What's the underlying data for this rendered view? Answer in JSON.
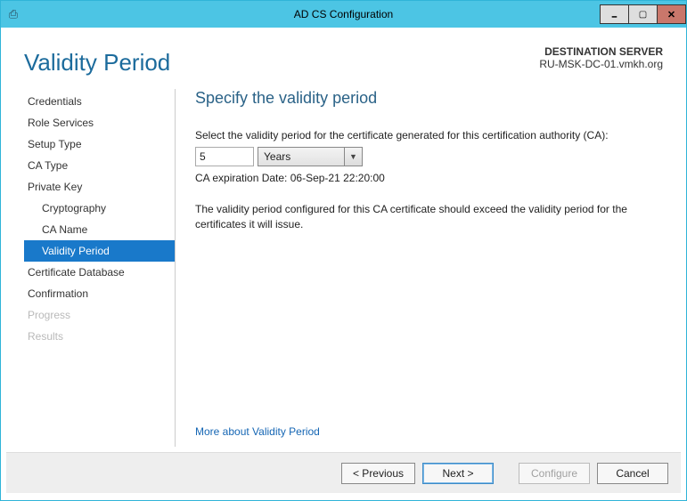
{
  "window": {
    "title": "AD CS Configuration"
  },
  "header": {
    "heading": "Validity Period",
    "destination_label": "DESTINATION SERVER",
    "destination_server": "RU-MSK-DC-01.vmkh.org"
  },
  "sidebar": {
    "items": [
      {
        "label": "Credentials",
        "sub": false,
        "selected": false,
        "disabled": false
      },
      {
        "label": "Role Services",
        "sub": false,
        "selected": false,
        "disabled": false
      },
      {
        "label": "Setup Type",
        "sub": false,
        "selected": false,
        "disabled": false
      },
      {
        "label": "CA Type",
        "sub": false,
        "selected": false,
        "disabled": false
      },
      {
        "label": "Private Key",
        "sub": false,
        "selected": false,
        "disabled": false
      },
      {
        "label": "Cryptography",
        "sub": true,
        "selected": false,
        "disabled": false
      },
      {
        "label": "CA Name",
        "sub": true,
        "selected": false,
        "disabled": false
      },
      {
        "label": "Validity Period",
        "sub": true,
        "selected": true,
        "disabled": false
      },
      {
        "label": "Certificate Database",
        "sub": false,
        "selected": false,
        "disabled": false
      },
      {
        "label": "Confirmation",
        "sub": false,
        "selected": false,
        "disabled": false
      },
      {
        "label": "Progress",
        "sub": false,
        "selected": false,
        "disabled": true
      },
      {
        "label": "Results",
        "sub": false,
        "selected": false,
        "disabled": true
      }
    ]
  },
  "main": {
    "title": "Specify the validity period",
    "prompt": "Select the validity period for the certificate generated for this certification authority (CA):",
    "value": "5",
    "unit": "Years",
    "expiration": "CA expiration Date: 06-Sep-21 22:20:00",
    "note": "The validity period configured for this CA certificate should exceed the validity period for the certificates it will issue.",
    "more_link": "More about Validity Period"
  },
  "footer": {
    "previous": "< Previous",
    "next": "Next >",
    "configure": "Configure",
    "cancel": "Cancel"
  }
}
